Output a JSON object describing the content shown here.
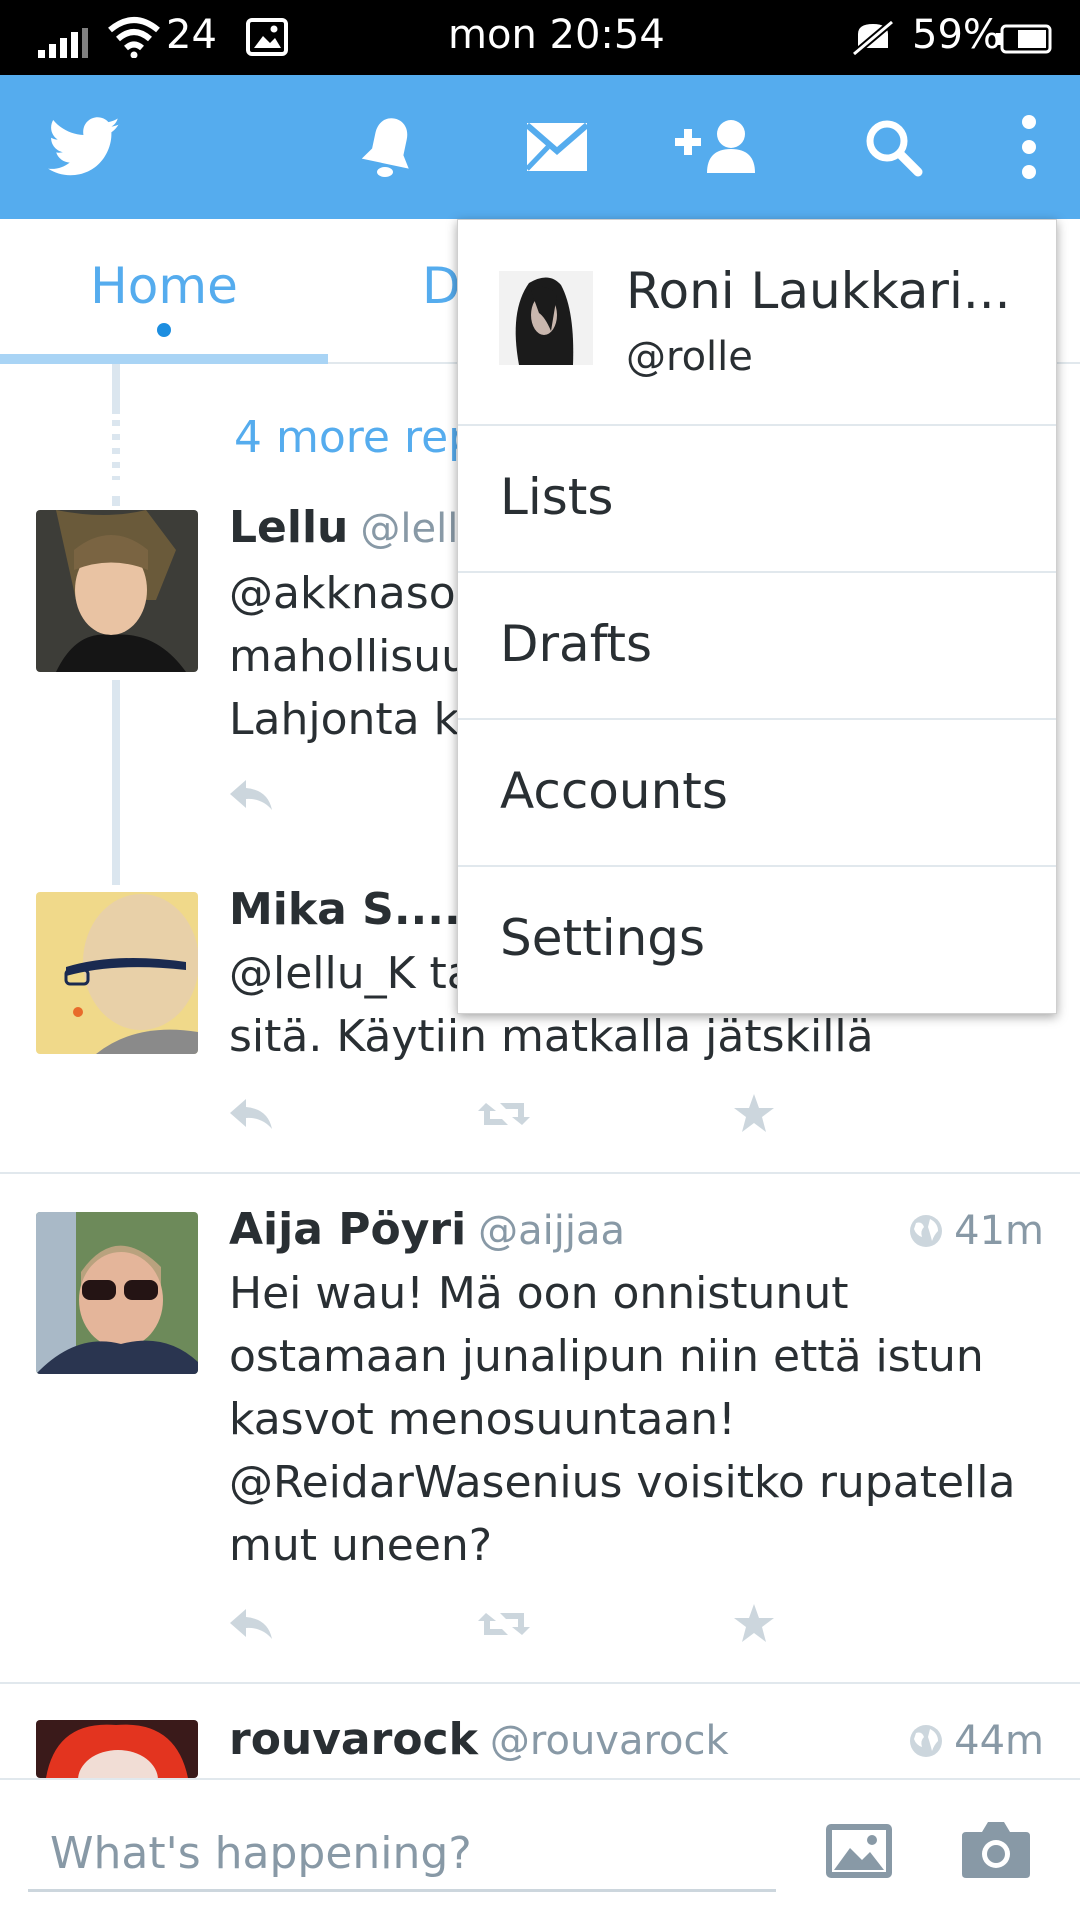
{
  "status_bar": {
    "signal_number": "24",
    "time": "mon 20:54",
    "battery": "59%"
  },
  "top_bar": {
    "icons": [
      "twitter-bird-icon",
      "bell-icon",
      "envelope-icon",
      "add-user-icon",
      "search-icon",
      "overflow-menu-icon"
    ]
  },
  "tabs": {
    "home": "Home",
    "second_partial": "D"
  },
  "thread": {
    "more_replies": "4 more rep"
  },
  "tweets": [
    {
      "name": "Lellu",
      "handle": "@lellu",
      "lines": [
        "@akknaso",
        "mahollisuu",
        "Lahjonta kä"
      ]
    },
    {
      "name": "Mika S......",
      "handle": "",
      "lines": [
        "@lellu_K ta",
        "sitä. Käytiin matkalla jätskillä"
      ]
    },
    {
      "name": "Aija Pöyri",
      "handle": "@aijjaa",
      "time": "41m",
      "lines": [
        "Hei wau! Mä oon onnistunut",
        "ostamaan junalipun niin että istun",
        "kasvot menosuuntaan!",
        "@ReidarWasenius voisitko rupatella",
        "mut uneen?"
      ]
    },
    {
      "name": "rouvarock",
      "handle": "@rouvarock",
      "time": "44m"
    }
  ],
  "compose": {
    "placeholder": "What's happening?"
  },
  "menu": {
    "profile_name": "Roni Laukkari...",
    "profile_handle": "@rolle",
    "items": [
      "Lists",
      "Drafts",
      "Accounts",
      "Settings"
    ]
  },
  "colors": {
    "brand": "#55acee",
    "text": "#292f33",
    "muted": "#8899a6"
  }
}
